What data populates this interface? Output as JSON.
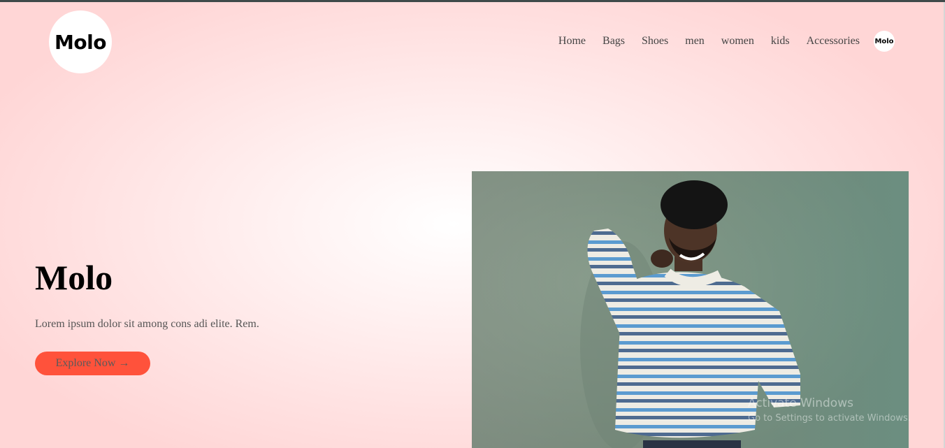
{
  "header": {
    "logo_text": "Molo",
    "nav": [
      "Home",
      "Bags",
      "Shoes",
      "men",
      "women",
      "kids",
      "Accessories"
    ],
    "nav_logo_text": "Molo"
  },
  "hero": {
    "title": "Molo",
    "text": "Lorem ipsum dolor sit among cons adi elite. Rem.",
    "button_label": "Explore Now →",
    "button_color": "#ff523b"
  },
  "overlay": {
    "watermark_line1": "Activate Windows",
    "watermark_line2": "Go to Settings to activate Windows."
  }
}
